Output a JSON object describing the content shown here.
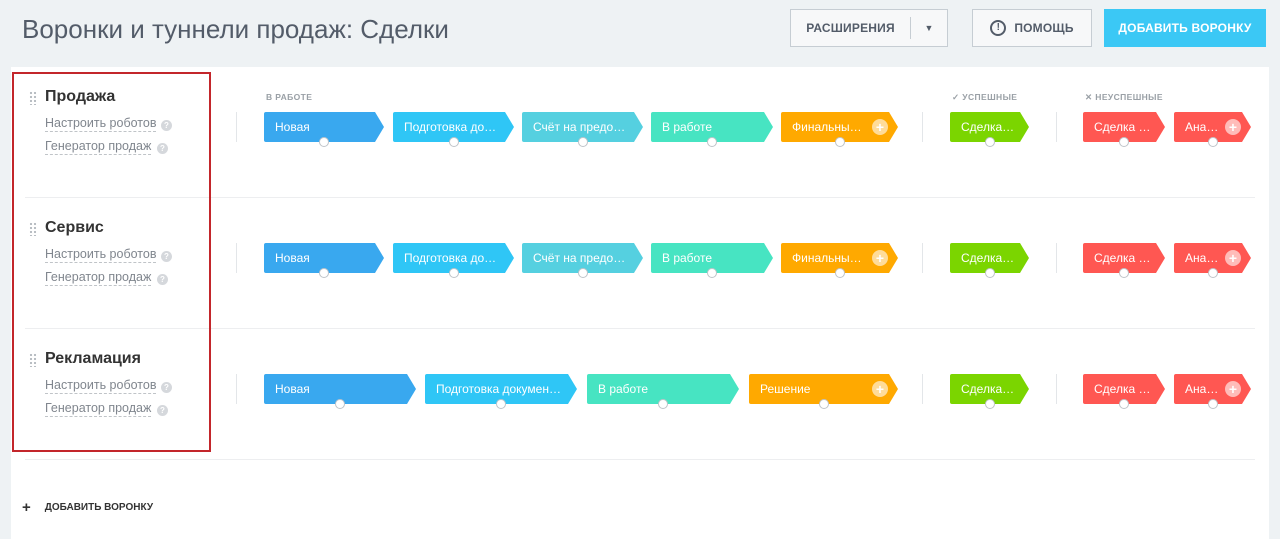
{
  "page_title": "Воронки и туннели продаж: Сделки",
  "header": {
    "extensions_label": "РАСШИРЕНИЯ",
    "extensions_arrow": "▼",
    "help_label": "ПОМОЩЬ",
    "help_icon": "!",
    "add_funnel_label": "ДОБАВИТЬ ВОРОНКУ"
  },
  "sections": {
    "in_work": "В РАБОТЕ",
    "success": "✓  УСПЕШНЫЕ",
    "fail": "✕  НЕУСПЕШНЫЕ"
  },
  "link_robots": "Настроить роботов",
  "link_generator": "Генератор продаж",
  "help_q": "?",
  "funnels": [
    {
      "name": "Продажа",
      "stages": [
        "Новая",
        "Подготовка документов",
        "Счёт на предоплату",
        "В работе",
        "Финальный счёт"
      ],
      "success": "Сделка успешна",
      "fail": [
        "Сделка провалена",
        "Анализ причины провала"
      ]
    },
    {
      "name": "Сервис",
      "stages": [
        "Новая",
        "Подготовка документов",
        "Счёт на предоплату",
        "В работе",
        "Финальный счёт"
      ],
      "success": "Сделка успешна",
      "fail": [
        "Сделка провалена",
        "Анализ причины провала"
      ]
    },
    {
      "name": "Рекламация",
      "stages": [
        "Новая",
        "Подготовка документов",
        "В работе",
        "Решение"
      ],
      "success": "Сделка успешна",
      "fail": [
        "Сделка провалена",
        "Анализ причины провала"
      ]
    }
  ],
  "add_funnel_bottom": "ДОБАВИТЬ ВОРОНКУ",
  "colors": {
    "stage_blue": "#39a8ef",
    "stage_cyan": "#2fc6f6",
    "stage_teal": "#55d0e0",
    "stage_mint": "#47e4c2",
    "stage_orange": "#ffa900",
    "success_green": "#7bd500",
    "fail_red": "#ff5752",
    "accent_button": "#3bc8f5",
    "highlight_frame": "#c3262b"
  }
}
